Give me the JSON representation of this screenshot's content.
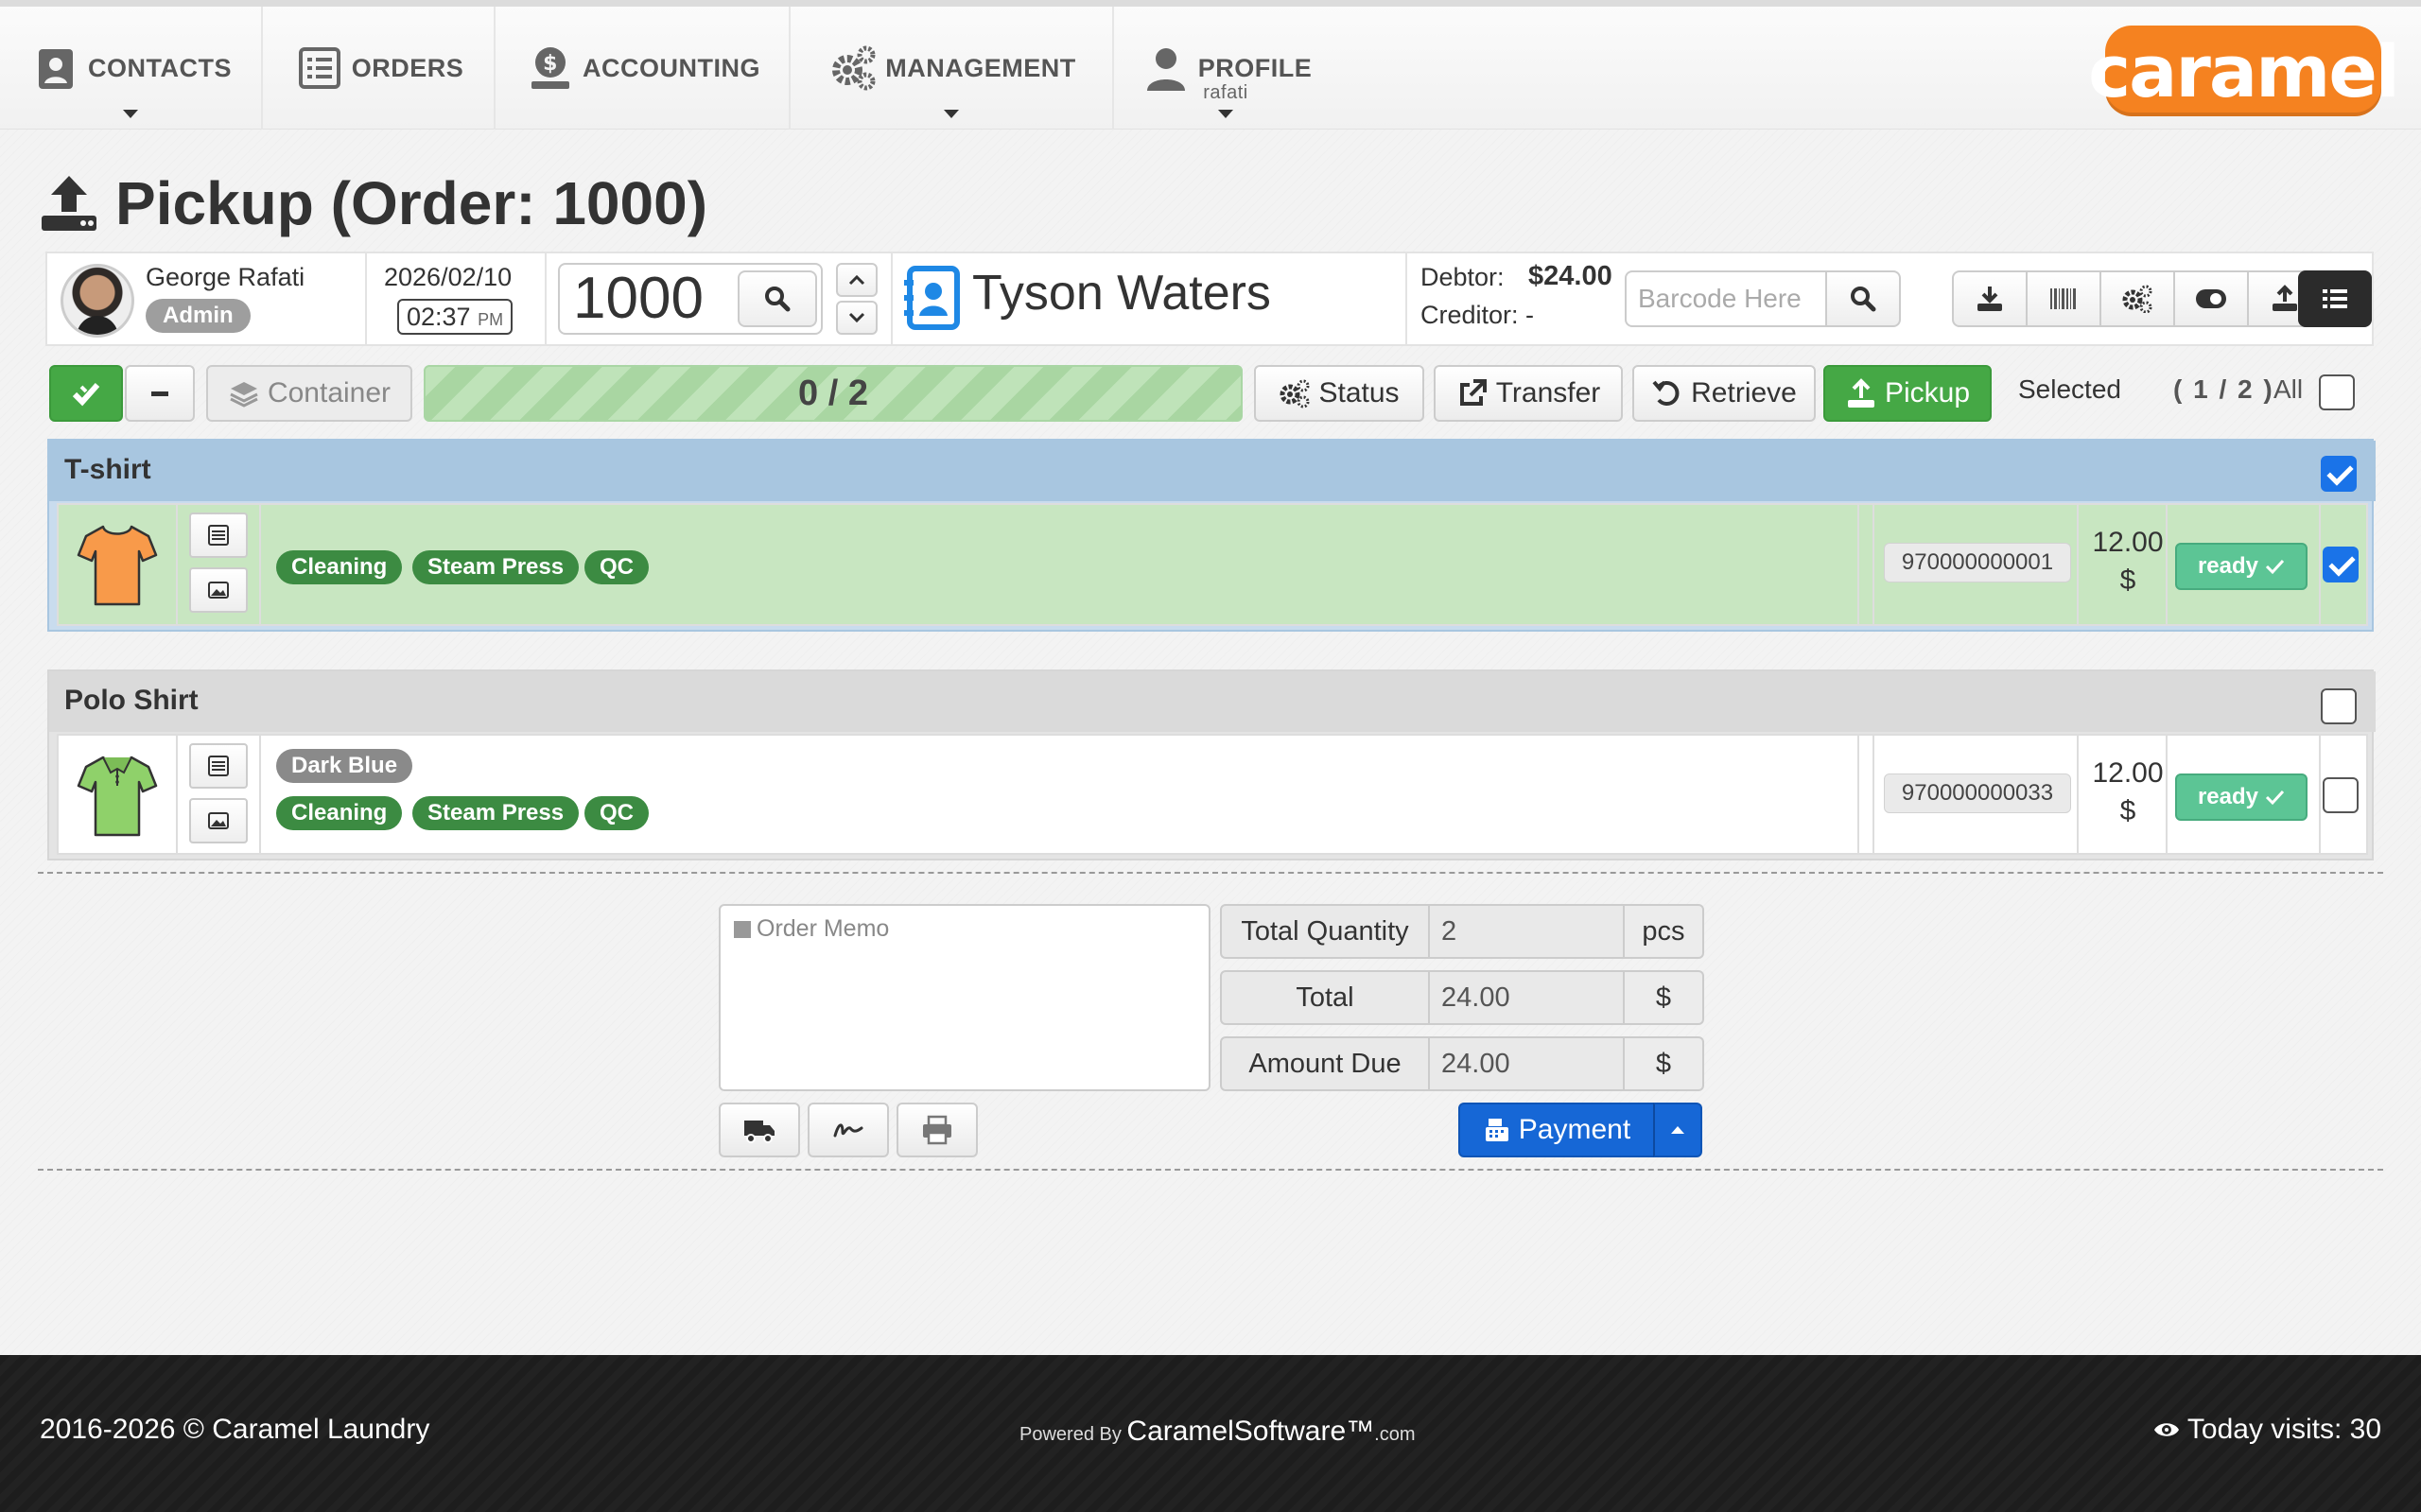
{
  "nav": {
    "contacts": "CONTACTS",
    "orders": "ORDERS",
    "accounting": "ACCOUNTING",
    "management": "MANAGEMENT",
    "profile": "PROFILE",
    "profile_user": "rafati",
    "logo": "caramel"
  },
  "page": {
    "title": "Pickup (Order: 1000)"
  },
  "info": {
    "user_name": "George Rafati",
    "user_role": "Admin",
    "date": "2026/02/10",
    "time": "02:37",
    "time_suffix": "PM",
    "order_number": "1000",
    "customer_name": "Tyson Waters",
    "debtor_label": "Debtor:",
    "debtor_value": "$24.00",
    "creditor_label": "Creditor: -",
    "barcode_placeholder": "Barcode Here"
  },
  "actions": {
    "container": "Container",
    "progress": "0 / 2",
    "status": "Status",
    "transfer": "Transfer",
    "retrieve": "Retrieve",
    "pickup": "Pickup",
    "selected_label": "Selected",
    "selected_count": "( 1 / 2 )",
    "all_label": "All"
  },
  "items": [
    {
      "name": "T-shirt",
      "selected": true,
      "attributes": [],
      "services": [
        "Cleaning",
        "Steam Press",
        "QC"
      ],
      "barcode": "970000000001",
      "price": "12.00",
      "currency": "$",
      "status": "ready",
      "color": "#f89a4a"
    },
    {
      "name": "Polo Shirt",
      "selected": false,
      "attributes": [
        "Dark Blue"
      ],
      "services": [
        "Cleaning",
        "Steam Press",
        "QC"
      ],
      "barcode": "970000000033",
      "price": "12.00",
      "currency": "$",
      "status": "ready",
      "color": "#8fd16a"
    }
  ],
  "summary": {
    "memo_placeholder": "Order Memo",
    "total_quantity_label": "Total Quantity",
    "total_quantity_value": "2",
    "total_quantity_unit": "pcs",
    "total_label": "Total",
    "total_value": "24.00",
    "total_unit": "$",
    "amount_due_label": "Amount Due",
    "amount_due_value": "24.00",
    "amount_due_unit": "$",
    "payment": "Payment"
  },
  "footer": {
    "copyright": "2016-2026 © Caramel Laundry",
    "powered_by": "Powered By",
    "powered_brand": "CaramelSoftware™",
    "powered_domain": ".com",
    "visits": "Today visits: 30"
  },
  "colors": {
    "accent_green": "#45a845",
    "accent_blue": "#1667d6",
    "logo_orange": "#f58220",
    "selected_row_bg": "#c8e6c1",
    "selected_header_bg": "#a8c6e0"
  }
}
